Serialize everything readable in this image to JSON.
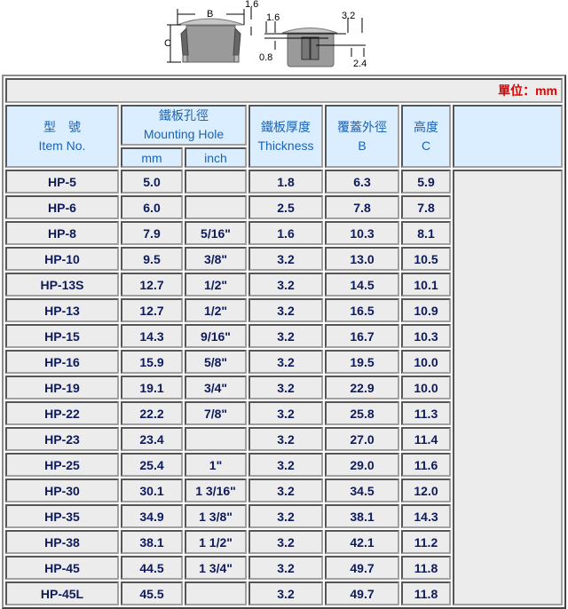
{
  "diagram": {
    "left_view": {
      "label_B": "B",
      "label_C": "C",
      "label_cap": "1.6"
    },
    "right_view": {
      "label_16": "1.6",
      "label_32": "3.2",
      "label_08": "0.8",
      "label_24": "2.4"
    }
  },
  "unit_note": "單位：mm",
  "headers": {
    "item_zh": "型　號",
    "item_en": "Item No.",
    "hole_zh": "鐵板孔徑",
    "hole_en": "Mounting Hole",
    "hole_mm": "mm",
    "hole_inch": "inch",
    "thick_zh": "鐵板厚度",
    "thick_en": "Thickness",
    "b_zh": "覆蓋外徑",
    "b_en": "B",
    "c_zh": "高度",
    "c_en": "C"
  },
  "rows": [
    {
      "item": "HP-5",
      "mm": "5.0",
      "inch": "",
      "thickness": "1.8",
      "b": "6.3",
      "c": "5.9"
    },
    {
      "item": "HP-6",
      "mm": "6.0",
      "inch": "",
      "thickness": "2.5",
      "b": "7.8",
      "c": "7.8"
    },
    {
      "item": "HP-8",
      "mm": "7.9",
      "inch": "5/16\"",
      "thickness": "1.6",
      "b": "10.3",
      "c": "8.1"
    },
    {
      "item": "HP-10",
      "mm": "9.5",
      "inch": "3/8\"",
      "thickness": "3.2",
      "b": "13.0",
      "c": "10.5"
    },
    {
      "item": "HP-13S",
      "mm": "12.7",
      "inch": "1/2\"",
      "thickness": "3.2",
      "b": "14.5",
      "c": "10.1"
    },
    {
      "item": "HP-13",
      "mm": "12.7",
      "inch": "1/2\"",
      "thickness": "3.2",
      "b": "16.5",
      "c": "10.9"
    },
    {
      "item": "HP-15",
      "mm": "14.3",
      "inch": "9/16\"",
      "thickness": "3.2",
      "b": "16.7",
      "c": "10.3"
    },
    {
      "item": "HP-16",
      "mm": "15.9",
      "inch": "5/8\"",
      "thickness": "3.2",
      "b": "19.5",
      "c": "10.0"
    },
    {
      "item": "HP-19",
      "mm": "19.1",
      "inch": "3/4\"",
      "thickness": "3.2",
      "b": "22.9",
      "c": "10.0"
    },
    {
      "item": "HP-22",
      "mm": "22.2",
      "inch": "7/8\"",
      "thickness": "3.2",
      "b": "25.8",
      "c": "11.3"
    },
    {
      "item": "HP-23",
      "mm": "23.4",
      "inch": "",
      "thickness": "3.2",
      "b": "27.0",
      "c": "11.4"
    },
    {
      "item": "HP-25",
      "mm": "25.4",
      "inch": "1\"",
      "thickness": "3.2",
      "b": "29.0",
      "c": "11.6"
    },
    {
      "item": "HP-30",
      "mm": "30.1",
      "inch": "1 3/16\"",
      "thickness": "3.2",
      "b": "34.5",
      "c": "12.0"
    },
    {
      "item": "HP-35",
      "mm": "34.9",
      "inch": "1 3/8\"",
      "thickness": "3.2",
      "b": "38.1",
      "c": "14.3"
    },
    {
      "item": "HP-38",
      "mm": "38.1",
      "inch": "1 1/2\"",
      "thickness": "3.2",
      "b": "42.1",
      "c": "11.2"
    },
    {
      "item": "HP-45",
      "mm": "44.5",
      "inch": "1 3/4\"",
      "thickness": "3.2",
      "b": "49.7",
      "c": "11.8"
    },
    {
      "item": "HP-45L",
      "mm": "45.5",
      "inch": "",
      "thickness": "3.2",
      "b": "49.7",
      "c": "11.8"
    }
  ]
}
